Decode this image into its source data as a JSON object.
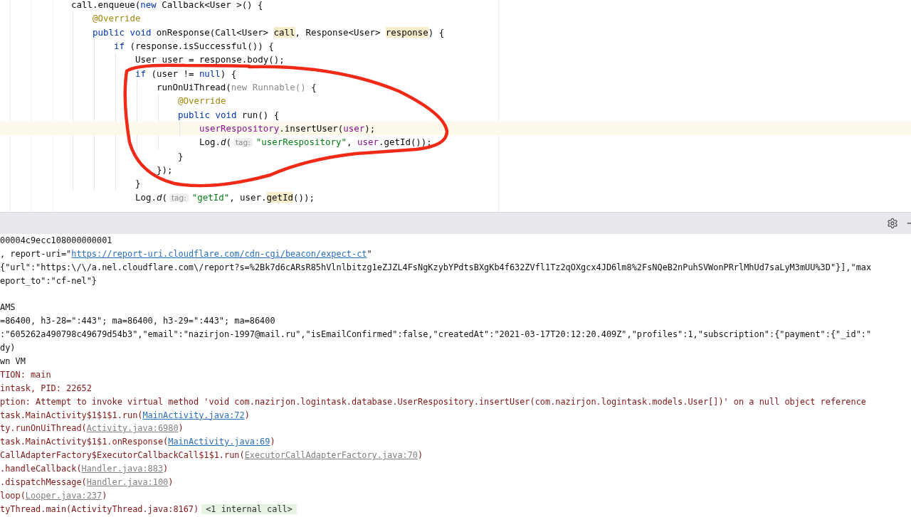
{
  "editor": {
    "lines": [
      {
        "tokens": [
          {
            "kind": "plain",
            "text": "call.enqueue("
          },
          {
            "kind": "keyword",
            "text": "new"
          },
          {
            "kind": "plain",
            "text": " Callback<User >() {"
          }
        ],
        "children": [
          {
            "tokens": [
              {
                "kind": "annotation",
                "text": "@Override"
              }
            ]
          },
          {
            "tokens": [
              {
                "kind": "keyword",
                "text": "public void"
              },
              {
                "kind": "plain",
                "text": " onResponse(Call<User> "
              },
              {
                "kind": "usage",
                "text": "call"
              },
              {
                "kind": "plain",
                "text": ", Response<User> "
              },
              {
                "kind": "usage",
                "text": "response"
              },
              {
                "kind": "plain",
                "text": ") {"
              }
            ],
            "children": [
              {
                "tokens": [
                  {
                    "kind": "keyword",
                    "text": "if"
                  },
                  {
                    "kind": "plain",
                    "text": " (response.isSuccessful()) {"
                  }
                ],
                "children": [
                  {
                    "tokens": [
                      {
                        "kind": "plain",
                        "text": "User user = response.body();"
                      }
                    ]
                  },
                  {
                    "tokens": [
                      {
                        "kind": "keyword",
                        "text": "if"
                      },
                      {
                        "kind": "plain",
                        "text": " (user != "
                      },
                      {
                        "kind": "keyword",
                        "text": "null"
                      },
                      {
                        "kind": "plain",
                        "text": ") {"
                      }
                    ],
                    "children": [
                      {
                        "tokens": [
                          {
                            "kind": "plain",
                            "text": "runOnUiThread("
                          },
                          {
                            "kind": "muted",
                            "text": "new Runnable()"
                          },
                          {
                            "kind": "plain",
                            "text": " {"
                          }
                        ],
                        "children": [
                          {
                            "tokens": [
                              {
                                "kind": "annotation",
                                "text": "@Override"
                              }
                            ]
                          },
                          {
                            "tokens": [
                              {
                                "kind": "keyword",
                                "text": "public void"
                              },
                              {
                                "kind": "plain",
                                "text": " run() {"
                              }
                            ],
                            "children": [
                              {
                                "current": true,
                                "tokens": [
                                  {
                                    "kind": "field",
                                    "text": "userRespository"
                                  },
                                  {
                                    "kind": "plain",
                                    "text": ".insertUser("
                                  },
                                  {
                                    "kind": "field",
                                    "text": "user"
                                  },
                                  {
                                    "kind": "plain",
                                    "text": ");"
                                  }
                                ]
                              },
                              {
                                "current": false,
                                "tokens": [
                                  {
                                    "kind": "plain",
                                    "text": "Log."
                                  },
                                  {
                                    "kind": "italic",
                                    "text": "d"
                                  },
                                  {
                                    "kind": "plain",
                                    "text": "("
                                  },
                                  {
                                    "kind": "hint",
                                    "text": "tag:"
                                  },
                                  {
                                    "kind": "string",
                                    "text": "\"userRespository\""
                                  },
                                  {
                                    "kind": "plain",
                                    "text": ", "
                                  },
                                  {
                                    "kind": "field",
                                    "text": "user"
                                  },
                                  {
                                    "kind": "plain",
                                    "text": ".getId());"
                                  }
                                ]
                              }
                            ],
                            "close": "}"
                          }
                        ],
                        "close": "});"
                      }
                    ],
                    "close": "}"
                  },
                  {
                    "tokens": [
                      {
                        "kind": "plain",
                        "text": "Log."
                      },
                      {
                        "kind": "italic",
                        "text": "d"
                      },
                      {
                        "kind": "plain",
                        "text": "("
                      },
                      {
                        "kind": "hint",
                        "text": "tag:"
                      },
                      {
                        "kind": "string",
                        "text": "\"getId\""
                      },
                      {
                        "kind": "plain",
                        "text": ", user."
                      },
                      {
                        "kind": "usage",
                        "text": "getId"
                      },
                      {
                        "kind": "plain",
                        "text": "());"
                      }
                    ]
                  }
                ]
              }
            ]
          }
        ]
      }
    ]
  },
  "logcat": {
    "lines": [
      {
        "kind": "info",
        "parts": [
          {
            "kind": "text",
            "text": "00004c9ecc108000000001"
          }
        ]
      },
      {
        "kind": "info",
        "parts": [
          {
            "kind": "text",
            "text": ", report-uri=\""
          },
          {
            "kind": "link",
            "text": "https://report-uri.cloudflare.com/cdn-cgi/beacon/expect-ct"
          },
          {
            "kind": "text",
            "text": "\""
          }
        ]
      },
      {
        "kind": "info",
        "parts": [
          {
            "kind": "text",
            "text": "{\"url\":\"https:\\/\\/a.nel.cloudflare.com\\/report?s=%2Bk7d6cARsR85hVlnlbitzg1eZJZL4FsNgKzybYPdtsBXgKb4f632ZVfl1Tz2qOXgcx4JD6lm8%2FsNQeB2nPuhSVWonPRrlMhUd7saLyM3mUU%3D\"}],\"max"
          }
        ]
      },
      {
        "kind": "info",
        "parts": [
          {
            "kind": "text",
            "text": "eport_to\":\"cf-nel\"}"
          }
        ]
      },
      {
        "kind": "info"
      },
      {
        "kind": "info",
        "parts": [
          {
            "kind": "text",
            "text": "AMS"
          }
        ]
      },
      {
        "kind": "info",
        "parts": [
          {
            "kind": "text",
            "text": "=86400, h3-28=\":443\"; ma=86400, h3-29=\":443\"; ma=86400"
          }
        ]
      },
      {
        "kind": "info",
        "parts": [
          {
            "kind": "text",
            "text": ":\"605262a490798c49679d54b3\",\"email\":\"nazirjon-1997@mail.ru\",\"isEmailConfirmed\":false,\"createdAt\":\"2021-03-17T20:12:20.409Z\",\"profiles\":1,\"subscription\":{\"payment\":{\"_id\":\""
          }
        ]
      },
      {
        "kind": "info",
        "parts": [
          {
            "kind": "text",
            "text": "dy)"
          }
        ]
      },
      {
        "kind": "info",
        "parts": [
          {
            "kind": "text",
            "text": "wn VM"
          }
        ]
      },
      {
        "kind": "error",
        "parts": [
          {
            "kind": "text",
            "text": "TION: main"
          }
        ]
      },
      {
        "kind": "error",
        "parts": [
          {
            "kind": "text",
            "text": "intask, PID: 22652"
          }
        ]
      },
      {
        "kind": "error",
        "parts": [
          {
            "kind": "text",
            "text": "ption: Attempt to invoke virtual method 'void com.nazirjon.logintask.database.UserRespository.insertUser(com.nazirjon.logintask.models.User[])' on a null object reference"
          }
        ]
      },
      {
        "kind": "error",
        "parts": [
          {
            "kind": "text",
            "text": "task.MainActivity$1$1$1.run("
          },
          {
            "kind": "link",
            "text": "MainActivity.java:72"
          },
          {
            "kind": "text",
            "text": ")"
          }
        ]
      },
      {
        "kind": "error",
        "parts": [
          {
            "kind": "text",
            "text": "ty.runOnUiThread("
          },
          {
            "kind": "lib",
            "text": "Activity.java:6980"
          },
          {
            "kind": "text",
            "text": ")"
          }
        ]
      },
      {
        "kind": "error",
        "parts": [
          {
            "kind": "text",
            "text": "task.MainActivity$1$1.onResponse("
          },
          {
            "kind": "link",
            "text": "MainActivity.java:69"
          },
          {
            "kind": "text",
            "text": ")"
          }
        ]
      },
      {
        "kind": "error",
        "parts": [
          {
            "kind": "text",
            "text": "CallAdapterFactory$ExecutorCallbackCall$1$1.run("
          },
          {
            "kind": "lib",
            "text": "ExecutorCallAdapterFactory.java:70"
          },
          {
            "kind": "text",
            "text": ")"
          }
        ]
      },
      {
        "kind": "error",
        "parts": [
          {
            "kind": "text",
            "text": ".handleCallback("
          },
          {
            "kind": "lib",
            "text": "Handler.java:883"
          },
          {
            "kind": "text",
            "text": ")"
          }
        ]
      },
      {
        "kind": "error",
        "parts": [
          {
            "kind": "text",
            "text": ".dispatchMessage("
          },
          {
            "kind": "lib",
            "text": "Handler.java:100"
          },
          {
            "kind": "text",
            "text": ")"
          }
        ]
      },
      {
        "kind": "error",
        "parts": [
          {
            "kind": "text",
            "text": "loop("
          },
          {
            "kind": "lib",
            "text": "Looper.java:237"
          },
          {
            "kind": "text",
            "text": ")"
          }
        ]
      },
      {
        "kind": "error",
        "parts": [
          {
            "kind": "text",
            "text": "tyThread.main(ActivityThread.java:8167)"
          },
          {
            "kind": "folded",
            "text": "<1 internal call>"
          }
        ]
      }
    ]
  }
}
